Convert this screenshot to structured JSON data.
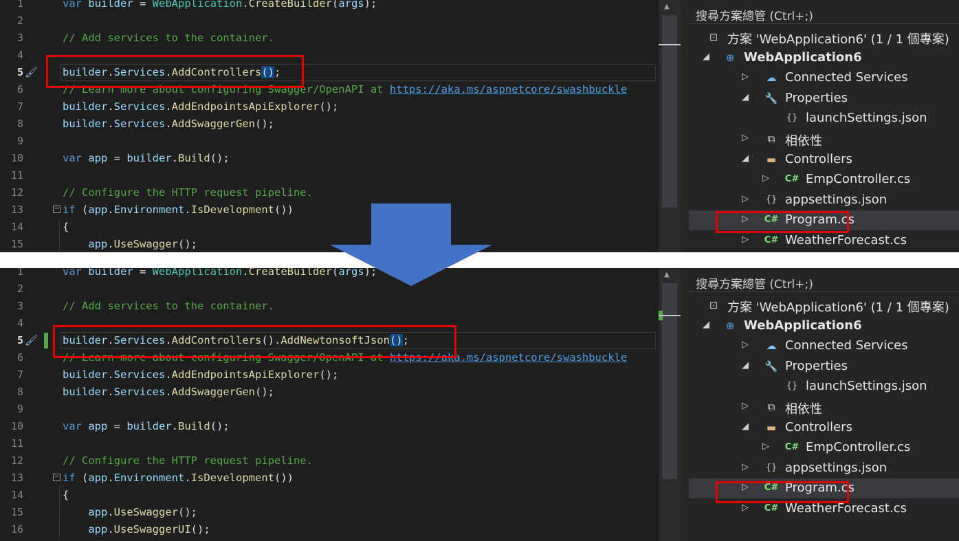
{
  "panes": [
    {
      "id": "before",
      "code_lines": [
        {
          "n": "1",
          "tokens": [
            [
              "kw",
              "var"
            ],
            [
              "p",
              " "
            ],
            [
              "id",
              "builder"
            ],
            [
              "p",
              " = "
            ],
            [
              "cls",
              "WebApplication"
            ],
            [
              "p",
              "."
            ],
            [
              "mth",
              "CreateBuilder"
            ],
            [
              "p",
              "("
            ],
            [
              "id",
              "args"
            ],
            [
              "p",
              ");"
            ]
          ]
        },
        {
          "n": "2",
          "tokens": []
        },
        {
          "n": "3",
          "tokens": [
            [
              "cm",
              "// Add services to the container."
            ]
          ]
        },
        {
          "n": "4",
          "tokens": []
        },
        {
          "n": "5",
          "current": true,
          "tokens": [
            [
              "id",
              "builder"
            ],
            [
              "p",
              "."
            ],
            [
              "id",
              "Services"
            ],
            [
              "p",
              "."
            ],
            [
              "mth",
              "AddControllers"
            ],
            [
              "hl",
              "()"
            ],
            [
              "p",
              ";"
            ]
          ]
        },
        {
          "n": "6",
          "tokens": [
            [
              "cm",
              "// Learn more about configuring Swagger/OpenAPI at "
            ],
            [
              "lnk",
              "https://aka.ms/aspnetcore/swashbuckle"
            ]
          ]
        },
        {
          "n": "7",
          "tokens": [
            [
              "id",
              "builder"
            ],
            [
              "p",
              "."
            ],
            [
              "id",
              "Services"
            ],
            [
              "p",
              "."
            ],
            [
              "mth",
              "AddEndpointsApiExplorer"
            ],
            [
              "p",
              "();"
            ]
          ]
        },
        {
          "n": "8",
          "tokens": [
            [
              "id",
              "builder"
            ],
            [
              "p",
              "."
            ],
            [
              "id",
              "Services"
            ],
            [
              "p",
              "."
            ],
            [
              "mth",
              "AddSwaggerGen"
            ],
            [
              "p",
              "();"
            ]
          ]
        },
        {
          "n": "9",
          "tokens": []
        },
        {
          "n": "10",
          "tokens": [
            [
              "kw",
              "var"
            ],
            [
              "p",
              " "
            ],
            [
              "id",
              "app"
            ],
            [
              "p",
              " = "
            ],
            [
              "id",
              "builder"
            ],
            [
              "p",
              "."
            ],
            [
              "mth",
              "Build"
            ],
            [
              "p",
              "();"
            ]
          ]
        },
        {
          "n": "11",
          "tokens": []
        },
        {
          "n": "12",
          "tokens": [
            [
              "cm",
              "// Configure the HTTP request pipeline."
            ]
          ]
        },
        {
          "n": "13",
          "tokens": [
            [
              "kw",
              "if"
            ],
            [
              "p",
              " ("
            ],
            [
              "id",
              "app"
            ],
            [
              "p",
              "."
            ],
            [
              "id",
              "Environment"
            ],
            [
              "p",
              "."
            ],
            [
              "mth",
              "IsDevelopment"
            ],
            [
              "p",
              "())"
            ]
          ]
        },
        {
          "n": "14",
          "tokens": [
            [
              "p",
              "{"
            ]
          ]
        },
        {
          "n": "15",
          "tokens": [
            [
              "p",
              "    "
            ],
            [
              "id",
              "app"
            ],
            [
              "p",
              "."
            ],
            [
              "mth",
              "UseSwagger"
            ],
            [
              "p",
              "();"
            ]
          ]
        }
      ]
    },
    {
      "id": "after",
      "code_lines": [
        {
          "n": "1",
          "tokens": [
            [
              "kw",
              "var"
            ],
            [
              "p",
              " "
            ],
            [
              "id",
              "builder"
            ],
            [
              "p",
              " = "
            ],
            [
              "cls",
              "WebApplication"
            ],
            [
              "p",
              "."
            ],
            [
              "mth",
              "CreateBuilder"
            ],
            [
              "p",
              "("
            ],
            [
              "id",
              "args"
            ],
            [
              "p",
              ");"
            ]
          ]
        },
        {
          "n": "2",
          "tokens": []
        },
        {
          "n": "3",
          "tokens": [
            [
              "cm",
              "// Add services to the container."
            ]
          ]
        },
        {
          "n": "4",
          "tokens": []
        },
        {
          "n": "5",
          "current": true,
          "tokens": [
            [
              "id",
              "builder"
            ],
            [
              "p",
              "."
            ],
            [
              "id",
              "Services"
            ],
            [
              "p",
              "."
            ],
            [
              "mth",
              "AddControllers"
            ],
            [
              "p",
              "()."
            ],
            [
              "mth",
              "AddNewtonsoftJson"
            ],
            [
              "hl",
              "()"
            ],
            [
              "p",
              ";"
            ]
          ]
        },
        {
          "n": "6",
          "tokens": [
            [
              "cm",
              "// Learn more about configuring Swagger/OpenAPI at "
            ],
            [
              "lnk",
              "https://aka.ms/aspnetcore/swashbuckle"
            ]
          ]
        },
        {
          "n": "7",
          "tokens": [
            [
              "id",
              "builder"
            ],
            [
              "p",
              "."
            ],
            [
              "id",
              "Services"
            ],
            [
              "p",
              "."
            ],
            [
              "mth",
              "AddEndpointsApiExplorer"
            ],
            [
              "p",
              "();"
            ]
          ]
        },
        {
          "n": "8",
          "tokens": [
            [
              "id",
              "builder"
            ],
            [
              "p",
              "."
            ],
            [
              "id",
              "Services"
            ],
            [
              "p",
              "."
            ],
            [
              "mth",
              "AddSwaggerGen"
            ],
            [
              "p",
              "();"
            ]
          ]
        },
        {
          "n": "9",
          "tokens": []
        },
        {
          "n": "10",
          "tokens": [
            [
              "kw",
              "var"
            ],
            [
              "p",
              " "
            ],
            [
              "id",
              "app"
            ],
            [
              "p",
              " = "
            ],
            [
              "id",
              "builder"
            ],
            [
              "p",
              "."
            ],
            [
              "mth",
              "Build"
            ],
            [
              "p",
              "();"
            ]
          ]
        },
        {
          "n": "11",
          "tokens": []
        },
        {
          "n": "12",
          "tokens": [
            [
              "cm",
              "// Configure the HTTP request pipeline."
            ]
          ]
        },
        {
          "n": "13",
          "tokens": [
            [
              "kw",
              "if"
            ],
            [
              "p",
              " ("
            ],
            [
              "id",
              "app"
            ],
            [
              "p",
              "."
            ],
            [
              "id",
              "Environment"
            ],
            [
              "p",
              "."
            ],
            [
              "mth",
              "IsDevelopment"
            ],
            [
              "p",
              "())"
            ]
          ]
        },
        {
          "n": "14",
          "tokens": [
            [
              "p",
              "{"
            ]
          ]
        },
        {
          "n": "15",
          "tokens": [
            [
              "p",
              "    "
            ],
            [
              "id",
              "app"
            ],
            [
              "p",
              "."
            ],
            [
              "mth",
              "UseSwagger"
            ],
            [
              "p",
              "();"
            ]
          ]
        },
        {
          "n": "16",
          "tokens": [
            [
              "p",
              "    "
            ],
            [
              "id",
              "app"
            ],
            [
              "p",
              "."
            ],
            [
              "mth",
              "UseSwaggerUI"
            ],
            [
              "p",
              "();"
            ]
          ]
        }
      ]
    }
  ],
  "solution_explorer": {
    "search_placeholder": "搜尋方案總管 (Ctrl+;)",
    "nodes": [
      {
        "label": "方案 'WebApplication6' (1 / 1 個專案)",
        "icon": "solution-icon",
        "glyph": "⊡",
        "color": "#c5c5c5",
        "expander": ""
      },
      {
        "label": "WebApplication6",
        "icon": "web-project-icon",
        "glyph": "⊕",
        "color": "#5aa0e6",
        "expander": "◢",
        "bold": true
      },
      {
        "label": "Connected Services",
        "icon": "connected-services-icon",
        "glyph": "☁",
        "color": "#75bfff",
        "expander": "▷"
      },
      {
        "label": "Properties",
        "icon": "properties-icon",
        "glyph": "🔧",
        "color": "#c9c9c9",
        "expander": "◢"
      },
      {
        "label": "launchSettings.json",
        "icon": "json-file-icon",
        "glyph": "{}",
        "color": "#c9c9c9",
        "expander": ""
      },
      {
        "label": "相依性",
        "icon": "dependencies-icon",
        "glyph": "⧉",
        "color": "#d0d0d0",
        "expander": "▷"
      },
      {
        "label": "Controllers",
        "icon": "folder-icon",
        "glyph": "▬",
        "color": "#dcb67a",
        "expander": "◢"
      },
      {
        "label": "EmpController.cs",
        "icon": "csharp-file-icon",
        "glyph": "C#",
        "color": "#7ee27e",
        "expander": "▷"
      },
      {
        "label": "appsettings.json",
        "icon": "json-file-icon",
        "glyph": "{}",
        "color": "#c9c9c9",
        "expander": "▷"
      },
      {
        "label": "Program.cs",
        "icon": "csharp-file-icon",
        "glyph": "C#",
        "color": "#7ee27e",
        "expander": "▷",
        "selected": true
      },
      {
        "label": "WeatherForecast.cs",
        "icon": "csharp-file-icon",
        "glyph": "C#",
        "color": "#7ee27e",
        "expander": "▷"
      }
    ]
  },
  "colors": {
    "highlight_box": "#e00000",
    "arrow": "#4472c4",
    "editor_bg": "#1e1e1e",
    "panel_bg": "#252526"
  }
}
